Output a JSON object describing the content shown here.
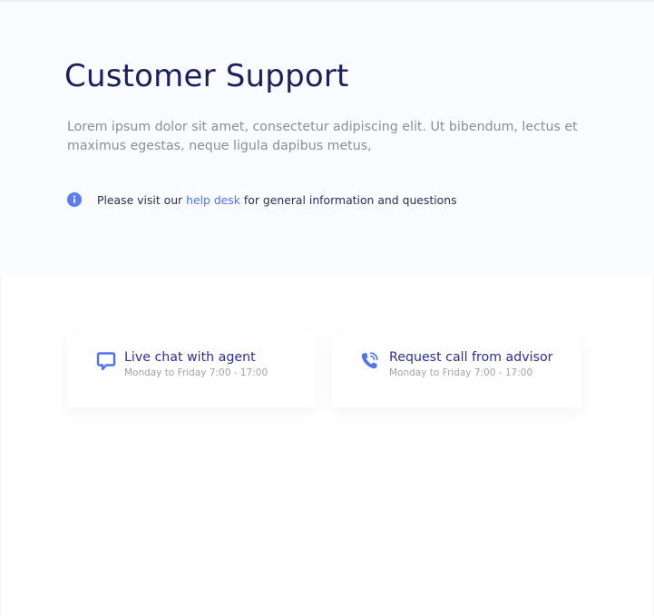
{
  "header": {
    "title": "Customer Support",
    "description": "Lorem ipsum dolor sit amet, consectetur adipiscing elit. Ut bibendum, lectus et maximus egestas, neque ligula dapibus metus,"
  },
  "info": {
    "icon": "info-icon",
    "prefix": "Please visit our ",
    "link_text": "help desk",
    "suffix": " for general information and questions"
  },
  "cards": [
    {
      "icon": "chat-bubble-icon",
      "title": "Live chat with agent",
      "subtitle": "Monday to Friday 7:00 - 17:00"
    },
    {
      "icon": "phone-call-icon",
      "title": "Request call from advisor",
      "subtitle": "Monday to Friday 7:00 - 17:00"
    }
  ],
  "colors": {
    "heading": "#1b1f5e",
    "accent": "#4e73f8",
    "card_title": "#2a2f9c",
    "muted": "#8b8d98",
    "hero_background": "#fafbfe"
  }
}
